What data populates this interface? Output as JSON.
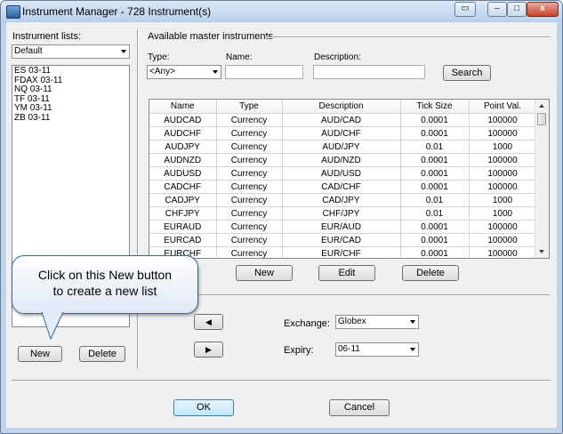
{
  "window": {
    "title": "Instrument Manager - 728 Instrument(s)",
    "controls": {
      "restore": "▭",
      "minimize": "–",
      "maximize": "□",
      "close": "x"
    }
  },
  "left": {
    "label": "Instrument lists:",
    "list_select": "Default",
    "items": [
      "ES 03-11",
      "FDAX 03-11",
      "NQ 03-11",
      "TF 03-11",
      "YM 03-11",
      "ZB 03-11"
    ],
    "new_label": "New",
    "delete_label": "Delete"
  },
  "master": {
    "group_label": "Available master instruments",
    "type_label": "Type:",
    "type_value": "<Any>",
    "name_label": "Name:",
    "name_value": "",
    "desc_label": "Description:",
    "desc_value": "",
    "search_label": "Search",
    "columns": [
      "Name",
      "Type",
      "Description",
      "Tick Size",
      "Point Val."
    ],
    "rows": [
      [
        "AUDCAD",
        "Currency",
        "AUD/CAD",
        "0.0001",
        "100000"
      ],
      [
        "AUDCHF",
        "Currency",
        "AUD/CHF",
        "0.0001",
        "100000"
      ],
      [
        "AUDJPY",
        "Currency",
        "AUD/JPY",
        "0.01",
        "1000"
      ],
      [
        "AUDNZD",
        "Currency",
        "AUD/NZD",
        "0.0001",
        "100000"
      ],
      [
        "AUDUSD",
        "Currency",
        "AUD/USD",
        "0.0001",
        "100000"
      ],
      [
        "CADCHF",
        "Currency",
        "CAD/CHF",
        "0.0001",
        "100000"
      ],
      [
        "CADJPY",
        "Currency",
        "CAD/JPY",
        "0.01",
        "1000"
      ],
      [
        "CHFJPY",
        "Currency",
        "CHF/JPY",
        "0.01",
        "1000"
      ],
      [
        "EURAUD",
        "Currency",
        "EUR/AUD",
        "0.0001",
        "100000"
      ],
      [
        "EURCAD",
        "Currency",
        "EUR/CAD",
        "0.0001",
        "100000"
      ],
      [
        "EURCHF",
        "Currency",
        "EUR/CHF",
        "0.0001",
        "100000"
      ]
    ],
    "new_label": "New",
    "edit_label": "Edit",
    "delete_label": "Delete"
  },
  "transfer": {
    "left_arrow": "◀",
    "right_arrow": "▶",
    "exchange_label": "Exchange:",
    "exchange_value": "Globex",
    "expiry_label": "Expiry:",
    "expiry_value": "06-11"
  },
  "footer": {
    "ok_label": "OK",
    "cancel_label": "Cancel"
  },
  "callout": {
    "line1": "Click on this New button",
    "line2": "to create a new list"
  }
}
